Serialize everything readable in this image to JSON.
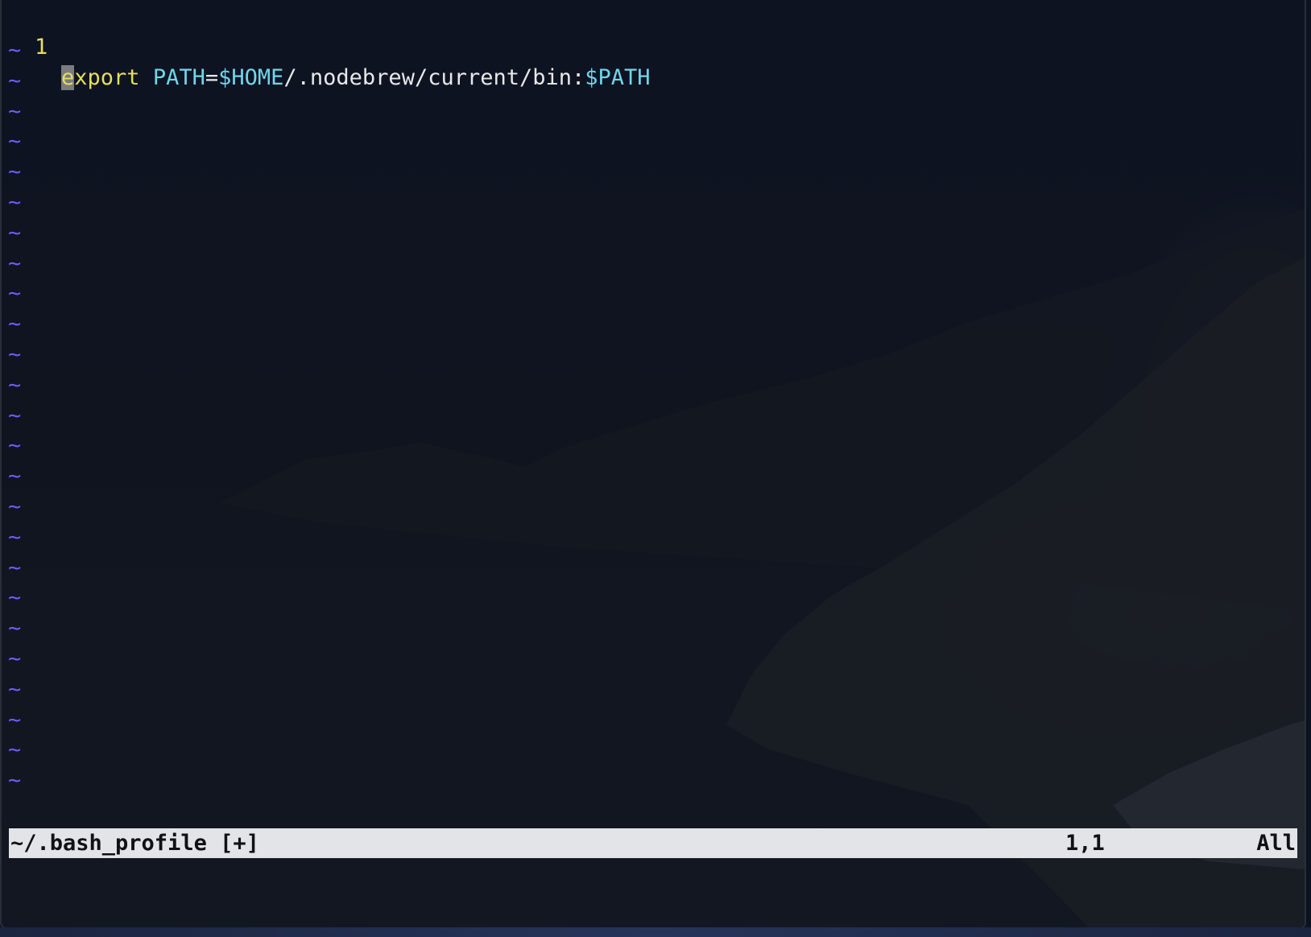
{
  "editor": {
    "line_number": "1",
    "cursor_char": "e",
    "keyword_rest": "xport",
    "space": " ",
    "var_name": "PATH",
    "equals": "=",
    "home_var": "$HOME",
    "path_text": "/.nodebrew/current/bin:",
    "path_var": "$PATH",
    "tilde_glyph": "~",
    "tilde_count": 25
  },
  "status": {
    "filename": "~/.bash_profile [+]",
    "position": "1,1",
    "scroll": "All"
  },
  "colors": {
    "keyword": "#e6de5c",
    "variable": "#6fd6ea",
    "tilde": "#6a5cff",
    "statusbar_bg": "#e3e4e8"
  }
}
